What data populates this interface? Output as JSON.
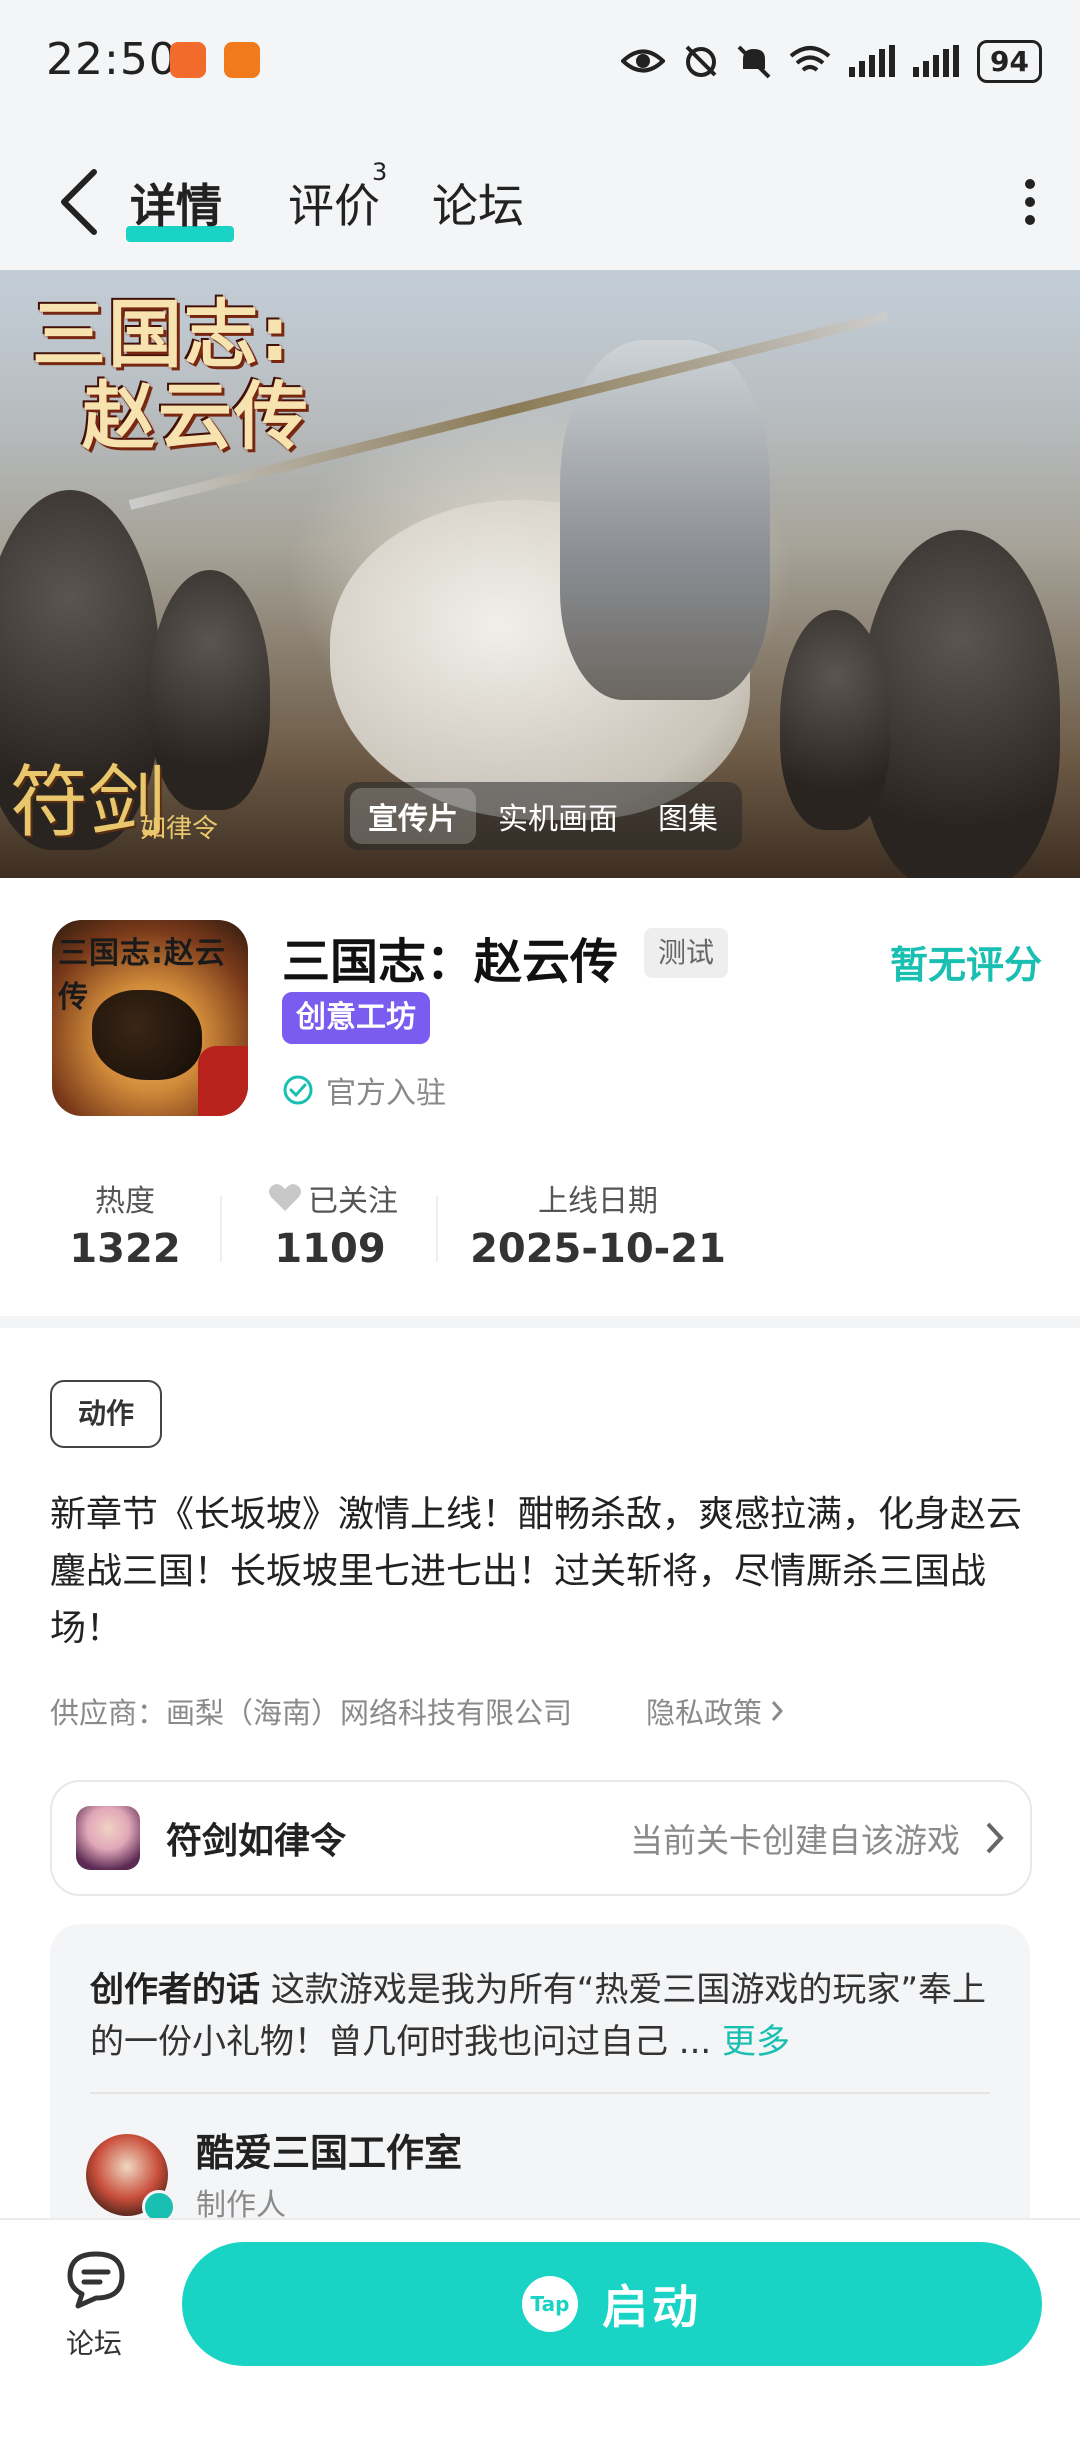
{
  "status_bar": {
    "time": "22:50",
    "battery": "94"
  },
  "header": {
    "tabs": [
      {
        "label": "详情"
      },
      {
        "label": "评价",
        "badge": "3"
      },
      {
        "label": "论坛"
      }
    ]
  },
  "hero": {
    "logo_line1": "三国志:",
    "logo_line2": "赵云传",
    "seal": "符剑",
    "seal_sub": "如律令",
    "media_tabs": [
      "宣传片",
      "实机画面",
      "图集"
    ]
  },
  "game": {
    "icon_title": "三国志:赵云传",
    "title": "三国志：赵云传",
    "test_badge": "测试",
    "rating": "暂无评分",
    "workshop_badge": "创意工坊",
    "official": "官方入驻"
  },
  "stats": [
    {
      "label": "热度",
      "value": "1322"
    },
    {
      "label": "已关注",
      "value": "1109"
    },
    {
      "label": "上线日期",
      "value": "2025-10-21"
    }
  ],
  "genre_tag": "动作",
  "description": "新章节《长坂坡》激情上线！酣畅杀敌，爽感拉满，化身赵云鏖战三国！长坂坡里七进七出！过关斩将，尽情厮杀三国战场！",
  "supplier": "供应商：画梨（海南）网络科技有限公司",
  "privacy": "隐私政策",
  "source_card": {
    "name": "符剑如律令",
    "hint": "当前关卡创建自该游戏"
  },
  "creator": {
    "heading": "创作者的话",
    "text": "这款游戏是我为所有“热爱三国游戏的玩家”奉上的一份小礼物！曾几何时我也问过自己 ...",
    "more": "更多",
    "studio_name": "酷爱三国工作室",
    "studio_role": "制作人"
  },
  "bottom_bar": {
    "forum_label": "论坛",
    "start_label": "启动",
    "tap_logo": "Tap"
  },
  "colors": {
    "accent": "#19d3c5",
    "rating": "#19bfb1",
    "workshop": "#7a5cf0"
  }
}
